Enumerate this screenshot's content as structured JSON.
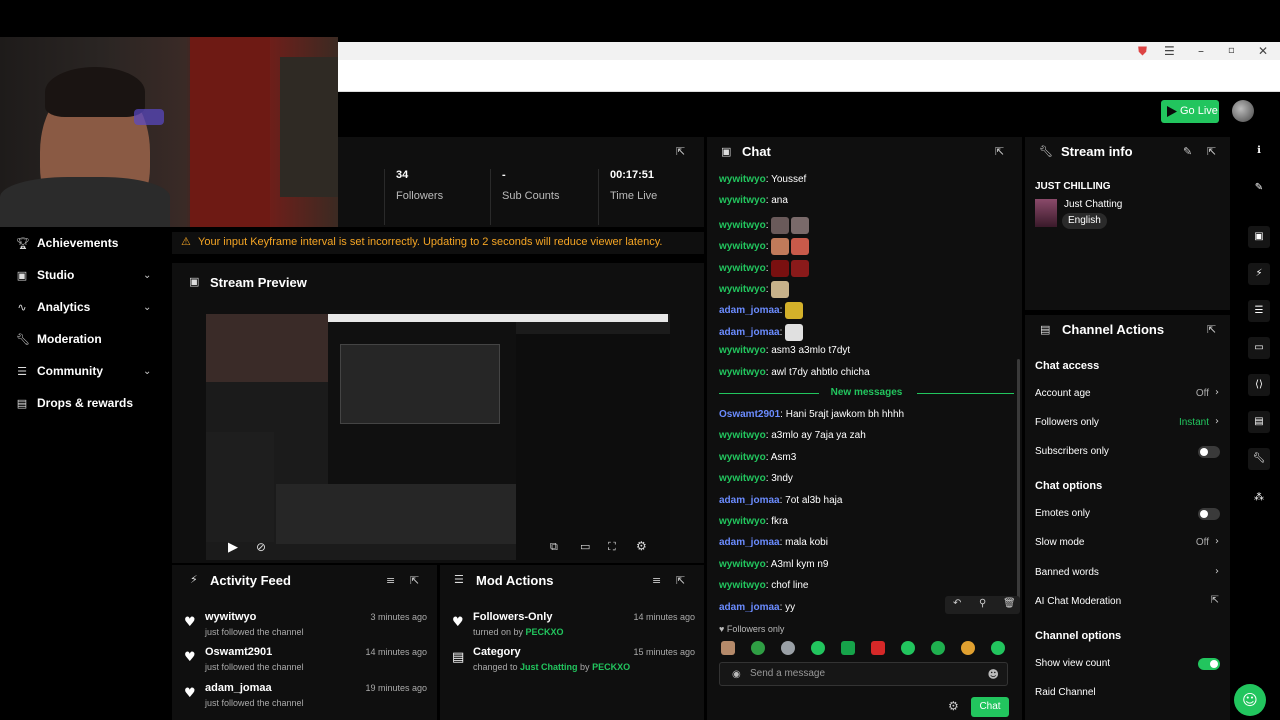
{
  "header": {
    "go_live_label": "Go Live"
  },
  "sidebar": {
    "items": [
      {
        "label": "Achievements",
        "icon": "trophy-icon",
        "expandable": false
      },
      {
        "label": "Studio",
        "icon": "studio-icon",
        "expandable": true
      },
      {
        "label": "Analytics",
        "icon": "analytics-icon",
        "expandable": true
      },
      {
        "label": "Moderation",
        "icon": "wrench-icon",
        "expandable": false
      },
      {
        "label": "Community",
        "icon": "community-icon",
        "expandable": true
      },
      {
        "label": "Drops & rewards",
        "icon": "gift-icon",
        "expandable": false
      }
    ]
  },
  "stats": [
    {
      "value": "34",
      "label": "Followers"
    },
    {
      "value": "-",
      "label": "Sub Counts"
    },
    {
      "value": "00:17:51",
      "label": "Time Live"
    }
  ],
  "warning": "Your input Keyframe interval is set incorrectly. Updating to 2 seconds will reduce viewer latency.",
  "preview": {
    "title": "Stream Preview"
  },
  "activity": {
    "title": "Activity Feed",
    "items": [
      {
        "name": "wywitwyo",
        "sub": "just followed the channel",
        "time": "3 minutes ago"
      },
      {
        "name": "Oswamt2901",
        "sub": "just followed the channel",
        "time": "14 minutes ago"
      },
      {
        "name": "adam_jomaa",
        "sub": "just followed the channel",
        "time": "19 minutes ago"
      }
    ]
  },
  "mod_actions": {
    "title": "Mod Actions",
    "items": [
      {
        "name": "Followers-Only",
        "pre": "turned on by ",
        "hl1": "PECKXO",
        "mid": "",
        "hl2": "",
        "time": "14 minutes ago"
      },
      {
        "name": "Category",
        "pre": "changed to ",
        "hl1": "Just Chatting",
        "mid": " by ",
        "hl2": "PECKXO",
        "time": "15 minutes ago"
      }
    ]
  },
  "chat": {
    "title": "Chat",
    "messages": [
      {
        "user": "wywitwyo",
        "color": "green",
        "text": "Youssef",
        "emotes": []
      },
      {
        "user": "wywitwyo",
        "color": "green",
        "text": "ana",
        "emotes": []
      },
      {
        "user": "wywitwyo",
        "color": "green",
        "text": "",
        "emotes": [
          "#6a5a5a",
          "#7a6a6a"
        ]
      },
      {
        "user": "wywitwyo",
        "color": "green",
        "text": "",
        "emotes": [
          "#c07a5a",
          "#c85a4a"
        ]
      },
      {
        "user": "wywitwyo",
        "color": "green",
        "text": "",
        "emotes": [
          "#7a1010",
          "#8a1a1a"
        ]
      },
      {
        "user": "wywitwyo",
        "color": "green",
        "text": "",
        "emotes": [
          "#c8b28a"
        ]
      },
      {
        "user": "adam_jomaa",
        "color": "blue",
        "text": "",
        "emotes": [
          "#d4b12a"
        ]
      },
      {
        "user": "adam_jomaa",
        "color": "blue",
        "text": "",
        "emotes": [
          "#e0e0e0"
        ]
      },
      {
        "user": "wywitwyo",
        "color": "green",
        "text": "asm3 a3mlo t7dyt",
        "emotes": []
      },
      {
        "user": "wywitwyo",
        "color": "green",
        "text": "awl t7dy ahbtlo chicha",
        "emotes": []
      }
    ],
    "new_messages_label": "New messages",
    "new_messages": [
      {
        "user": "Oswamt2901",
        "color": "blue",
        "text": "Hani 5rajt jawkom bh hhhh"
      },
      {
        "user": "wywitwyo",
        "color": "green",
        "text": "a3mlo ay 7aja ya zah"
      },
      {
        "user": "wywitwyo",
        "color": "green",
        "text": "Asm3"
      },
      {
        "user": "wywitwyo",
        "color": "green",
        "text": "3ndy"
      },
      {
        "user": "adam_jomaa",
        "color": "blue",
        "text": "7ot al3b haja"
      },
      {
        "user": "wywitwyo",
        "color": "green",
        "text": "fkra"
      },
      {
        "user": "adam_jomaa",
        "color": "blue",
        "text": "mala kobi"
      },
      {
        "user": "wywitwyo",
        "color": "green",
        "text": "A3ml kym n9"
      },
      {
        "user": "wywitwyo",
        "color": "green",
        "text": "chof line"
      },
      {
        "user": "adam_jomaa",
        "color": "blue",
        "text": "yy"
      }
    ],
    "followers_only": "Followers only",
    "input_placeholder": "Send a message",
    "send_label": "Chat"
  },
  "stream_info": {
    "title": "Stream info",
    "stream_title": "JUST CHILLING",
    "category": "Just Chatting",
    "language": "English"
  },
  "channel_actions": {
    "title": "Channel Actions",
    "chat_access": "Chat access",
    "account_age": {
      "label": "Account age",
      "value": "Off"
    },
    "followers_only": {
      "label": "Followers only",
      "value": "Instant"
    },
    "subscribers_only": {
      "label": "Subscribers only",
      "on": false
    },
    "chat_options": "Chat options",
    "emotes_only": {
      "label": "Emotes only",
      "on": false
    },
    "slow_mode": {
      "label": "Slow mode",
      "value": "Off"
    },
    "banned_words": {
      "label": "Banned words"
    },
    "ai_moderation": {
      "label": "AI Chat Moderation"
    },
    "channel_options": "Channel options",
    "show_view_count": {
      "label": "Show view count",
      "on": true
    },
    "raid_channel": {
      "label": "Raid Channel"
    }
  },
  "colors": {
    "accent": "#22c55e",
    "warning": "#f5a524",
    "user_blue": "#6b8cff",
    "panel_bg": "#0f0f0f"
  }
}
